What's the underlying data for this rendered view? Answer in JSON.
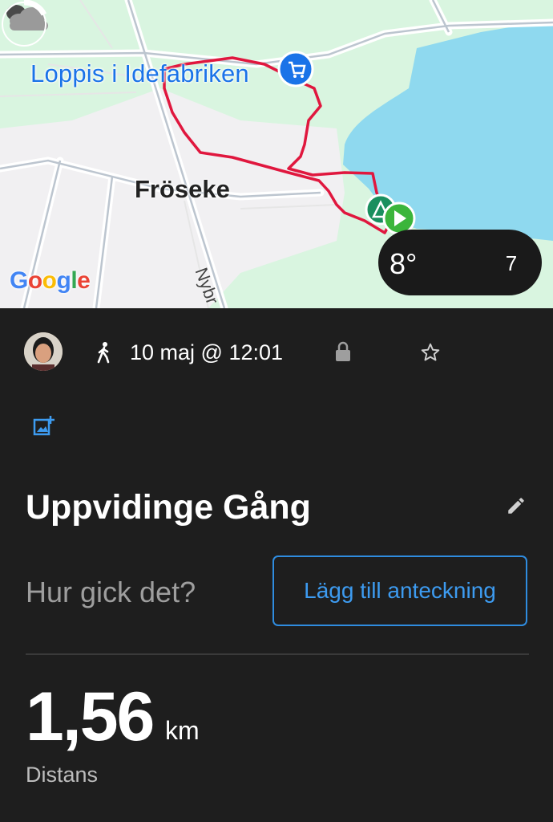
{
  "map": {
    "poi_label": "Loppis i Idefabriken",
    "town_label": "Fröseke",
    "road_label": "Nybr",
    "google_logo": [
      "G",
      "o",
      "o",
      "g",
      "l",
      "e"
    ],
    "google_colors": [
      "#4285F4",
      "#EA4335",
      "#FBBC05",
      "#4285F4",
      "#34A853",
      "#EA4335"
    ],
    "route_color": "#e0173e",
    "water_color": "#8fd9ef",
    "land_color": "#d9f5e0",
    "weather": {
      "temperature": "8°",
      "condition_icon": "cloud-icon",
      "uv_index": "7"
    }
  },
  "activity": {
    "type_icon": "walk-icon",
    "datetime": "10 maj @ 12:01",
    "privacy_icon": "lock-icon",
    "favorite_icon": "star-icon",
    "add_photo_icon": "add-photo-icon",
    "title": "Uppvidinge Gång",
    "edit_icon": "pencil-icon",
    "note_prompt": "Hur gick det?",
    "note_button": "Lägg till anteckning",
    "distance_value": "1,56",
    "distance_unit": "km",
    "distance_label": "Distans"
  },
  "colors": {
    "accent": "#3d9bf0",
    "background": "#1e1e1e"
  }
}
